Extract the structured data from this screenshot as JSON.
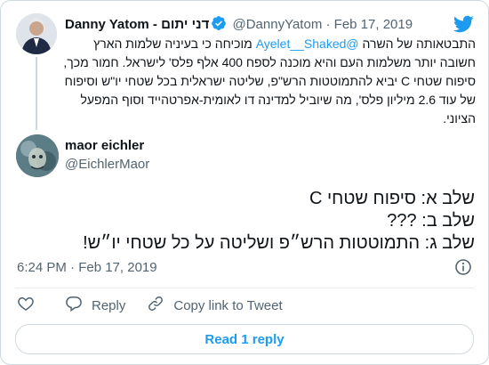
{
  "quoted_tweet": {
    "display_name": "Danny Yatom - דני יתום",
    "handle": "@DannyYatom",
    "separator": "·",
    "date": "Feb 17, 2019",
    "text_before_mention": "התבטאותה של השרה ",
    "mention": "@Ayelet__Shaked",
    "text_after_mention": " מוכיחה כי בעיניה שלמות הארץ חשובה יותר משלמות העם והיא מוכנה לספח 400 אלף פלס' לישראל. חמור מכך, סיפוח שטחי C יביא להתמוטטות הרש\"פ, שליטה ישראלית בכל שטחי יו\"ש וסיפוח של עוד 2.6 מיליון פלס', מה שיוביל למדינה דו לאומית-אפרטהייד וסוף המפעל הציוני."
  },
  "reply_tweet": {
    "display_name": "maor eichler",
    "handle": "@EichlerMaor",
    "lines": [
      "שלב א: סיפוח שטחי C",
      "שלב ב: ???",
      "שלב ג: התמוטטות הרש״פ ושליטה על כל שטחי יו״ש!"
    ],
    "timestamp": "6:24 PM · Feb 17, 2019"
  },
  "actions": {
    "reply_label": "Reply",
    "copy_link_label": "Copy link to Tweet"
  },
  "read_reply_label": "Read 1 reply",
  "colors": {
    "link": "#1d9bf0",
    "secondary_text": "#536471",
    "border": "#cfd9de"
  }
}
